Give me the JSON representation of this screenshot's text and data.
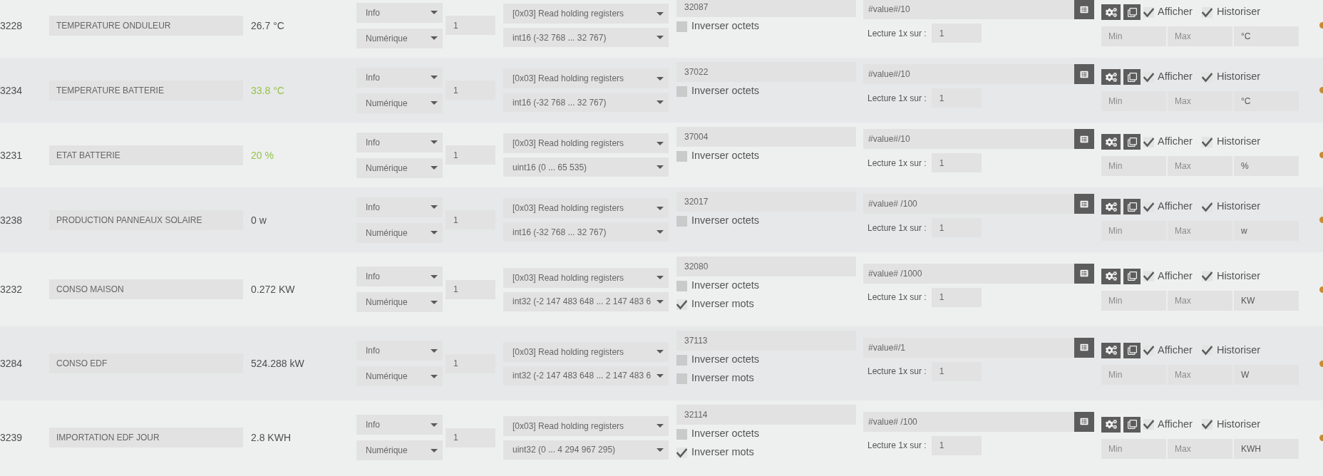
{
  "rows": [
    {
      "id": "3228",
      "name": "TEMPERATURE ONDULEUR",
      "value": {
        "text": "26.7 °C",
        "color": "#4f4f4f"
      },
      "category": "Info",
      "subtype": "Numérique",
      "count": "1",
      "function": "[0x03] Read holding registers",
      "format": "int16 (-32 768 ... 32 767)",
      "address": "32087",
      "byte_options": [
        {
          "label": "Inverser octets",
          "checked": false
        }
      ],
      "formula": "#value#/10",
      "poll_label": "Lecture 1x sur :",
      "poll": "1",
      "display": {
        "label": "Afficher",
        "checked": true
      },
      "history": {
        "label": "Historiser",
        "checked": true
      },
      "min": {
        "placeholder": "Min"
      },
      "max": {
        "placeholder": "Max"
      },
      "unit": "°C"
    },
    {
      "id": "3234",
      "name": "TEMPERATURE BATTERIE",
      "value": {
        "text": "33.8 °C",
        "color": "#96c34b"
      },
      "category": "Info",
      "subtype": "Numérique",
      "count": "1",
      "function": "[0x03] Read holding registers",
      "format": "int16 (-32 768 ... 32 767)",
      "address": "37022",
      "byte_options": [
        {
          "label": "Inverser octets",
          "checked": false
        }
      ],
      "formula": "#value#/10",
      "poll_label": "Lecture 1x sur :",
      "poll": "1",
      "display": {
        "label": "Afficher",
        "checked": true
      },
      "history": {
        "label": "Historiser",
        "checked": true
      },
      "min": {
        "placeholder": "Min"
      },
      "max": {
        "placeholder": "Max"
      },
      "unit": "°C"
    },
    {
      "id": "3231",
      "name": "ETAT BATTERIE",
      "value": {
        "text": "20 %",
        "color": "#96c34b"
      },
      "category": "Info",
      "subtype": "Numérique",
      "count": "1",
      "function": "[0x03] Read holding registers",
      "format": "uint16 (0 ... 65 535)",
      "address": "37004",
      "byte_options": [
        {
          "label": "Inverser octets",
          "checked": false
        }
      ],
      "formula": "#value#/10",
      "poll_label": "Lecture 1x sur :",
      "poll": "1",
      "display": {
        "label": "Afficher",
        "checked": true
      },
      "history": {
        "label": "Historiser",
        "checked": true
      },
      "min": {
        "placeholder": "Min"
      },
      "max": {
        "placeholder": "Max"
      },
      "unit": "%"
    },
    {
      "id": "3238",
      "name": "PRODUCTION PANNEAUX SOLAIRE",
      "value": {
        "text": "0 w",
        "color": "#4f4f4f"
      },
      "category": "Info",
      "subtype": "Numérique",
      "count": "1",
      "function": "[0x03] Read holding registers",
      "format": "int16 (-32 768 ... 32 767)",
      "address": "32017",
      "byte_options": [
        {
          "label": "Inverser octets",
          "checked": false
        }
      ],
      "formula": "#value# /100",
      "poll_label": "Lecture 1x sur :",
      "poll": "1",
      "display": {
        "label": "Afficher",
        "checked": true
      },
      "history": {
        "label": "Historiser",
        "checked": true
      },
      "min": {
        "placeholder": "Min"
      },
      "max": {
        "placeholder": "Max"
      },
      "unit": "w"
    },
    {
      "id": "3232",
      "name": "CONSO MAISON",
      "value": {
        "text": "0.272 KW",
        "color": "#4f4f4f"
      },
      "category": "Info",
      "subtype": "Numérique",
      "count": "1",
      "function": "[0x03] Read holding registers",
      "format": "int32 (-2 147 483 648 ... 2 147 483 6",
      "address": "32080",
      "byte_options": [
        {
          "label": "Inverser octets",
          "checked": false
        },
        {
          "label": "Inverser mots",
          "checked": true
        }
      ],
      "formula": "#value# /1000",
      "poll_label": "Lecture 1x sur :",
      "poll": "1",
      "display": {
        "label": "Afficher",
        "checked": true
      },
      "history": {
        "label": "Historiser",
        "checked": true
      },
      "min": {
        "placeholder": "Min"
      },
      "max": {
        "placeholder": "Max"
      },
      "unit": "KW"
    },
    {
      "id": "3284",
      "name": "CONSO EDF",
      "value": {
        "text": "524.288 kW",
        "color": "#4f4f4f"
      },
      "category": "Info",
      "subtype": "Numérique",
      "count": "1",
      "function": "[0x03] Read holding registers",
      "format": "int32 (-2 147 483 648 ... 2 147 483 6",
      "address": "37113",
      "byte_options": [
        {
          "label": "Inverser octets",
          "checked": false
        },
        {
          "label": "Inverser mots",
          "checked": false
        }
      ],
      "formula": "#value#/1",
      "poll_label": "Lecture 1x sur :",
      "poll": "1",
      "display": {
        "label": "Afficher",
        "checked": true
      },
      "history": {
        "label": "Historiser",
        "checked": true
      },
      "min": {
        "placeholder": "Min"
      },
      "max": {
        "placeholder": "Max"
      },
      "unit": "W"
    },
    {
      "id": "3239",
      "name": "IMPORTATION EDF JOUR",
      "value": {
        "text": "2.8 KWH",
        "color": "#4f4f4f"
      },
      "category": "Info",
      "subtype": "Numérique",
      "count": "1",
      "function": "[0x03] Read holding registers",
      "format": "uint32 (0 ... 4 294 967 295)",
      "address": "32114",
      "byte_options": [
        {
          "label": "Inverser octets",
          "checked": false
        },
        {
          "label": "Inverser mots",
          "checked": true
        }
      ],
      "formula": "#value# /100",
      "poll_label": "Lecture 1x sur :",
      "poll": "1",
      "display": {
        "label": "Afficher",
        "checked": true
      },
      "history": {
        "label": "Historiser",
        "checked": true
      },
      "min": {
        "placeholder": "Min"
      },
      "max": {
        "placeholder": "Max"
      },
      "unit": "KWH"
    }
  ]
}
